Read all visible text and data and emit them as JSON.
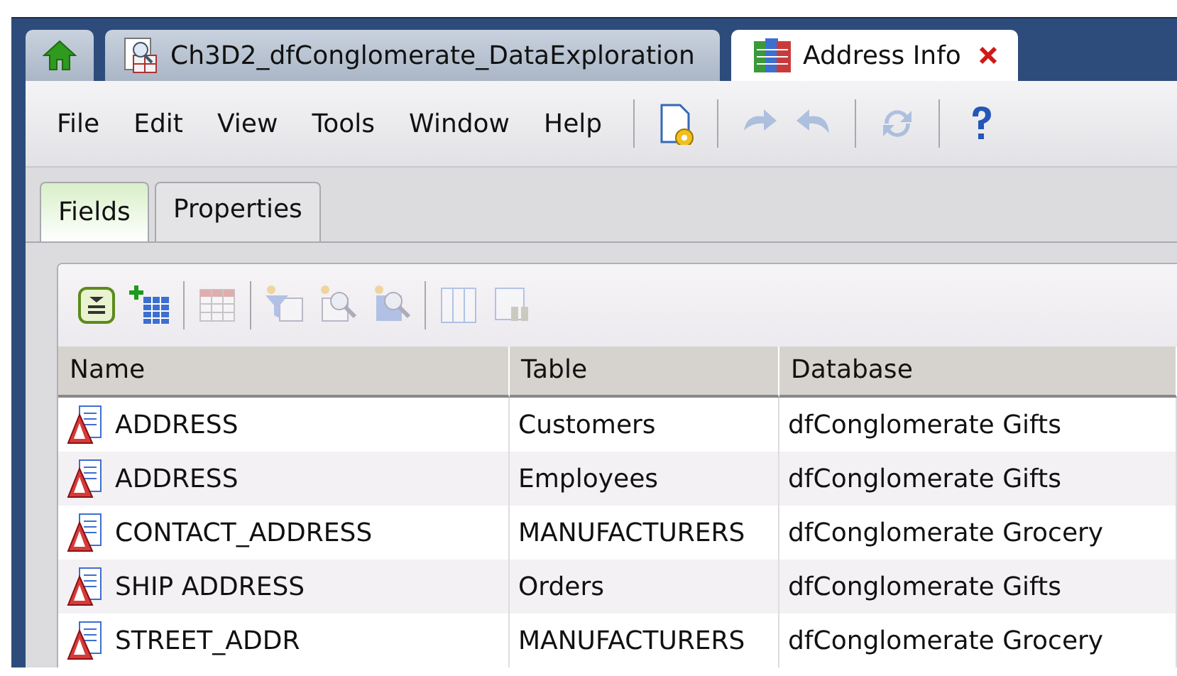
{
  "doc_tabs": [
    {
      "kind": "home",
      "selected": false
    },
    {
      "kind": "query",
      "label": "Ch3D2_dfConglomerate_DataExploration",
      "selected": false
    },
    {
      "kind": "table",
      "label": "Address Info",
      "selected": true,
      "closable": true
    }
  ],
  "menu": [
    "File",
    "Edit",
    "View",
    "Tools",
    "Window",
    "Help"
  ],
  "toolbar": [
    {
      "kind": "open",
      "disabled": false
    },
    {
      "kind": "separator"
    },
    {
      "kind": "redo",
      "disabled": true
    },
    {
      "kind": "undo",
      "disabled": true
    },
    {
      "kind": "separator"
    },
    {
      "kind": "refresh",
      "disabled": true
    },
    {
      "kind": "separator"
    },
    {
      "kind": "help",
      "disabled": false
    }
  ],
  "panel_tabs": [
    {
      "label": "Fields",
      "selected": true
    },
    {
      "label": "Properties",
      "selected": false
    }
  ],
  "grid_toolbar": [
    {
      "kind": "list",
      "disabled": false
    },
    {
      "kind": "add",
      "disabled": false
    },
    {
      "kind": "separator"
    },
    {
      "kind": "grid",
      "disabled": true
    },
    {
      "kind": "separator"
    },
    {
      "kind": "filter",
      "disabled": true
    },
    {
      "kind": "search",
      "disabled": true
    },
    {
      "kind": "search2",
      "disabled": true
    },
    {
      "kind": "separator"
    },
    {
      "kind": "columns",
      "disabled": true
    },
    {
      "kind": "find",
      "disabled": true
    }
  ],
  "table": {
    "columns": [
      "Name",
      "Table",
      "Database"
    ],
    "rows": [
      [
        "ADDRESS",
        "Customers",
        "dfConglomerate Gifts"
      ],
      [
        "ADDRESS",
        "Employees",
        "dfConglomerate Gifts"
      ],
      [
        "CONTACT_ADDRESS",
        "MANUFACTURERS",
        "dfConglomerate Grocery"
      ],
      [
        "SHIP ADDRESS",
        "Orders",
        "dfConglomerate Gifts"
      ],
      [
        "STREET_ADDR",
        "MANUFACTURERS",
        "dfConglomerate Grocery"
      ]
    ]
  }
}
